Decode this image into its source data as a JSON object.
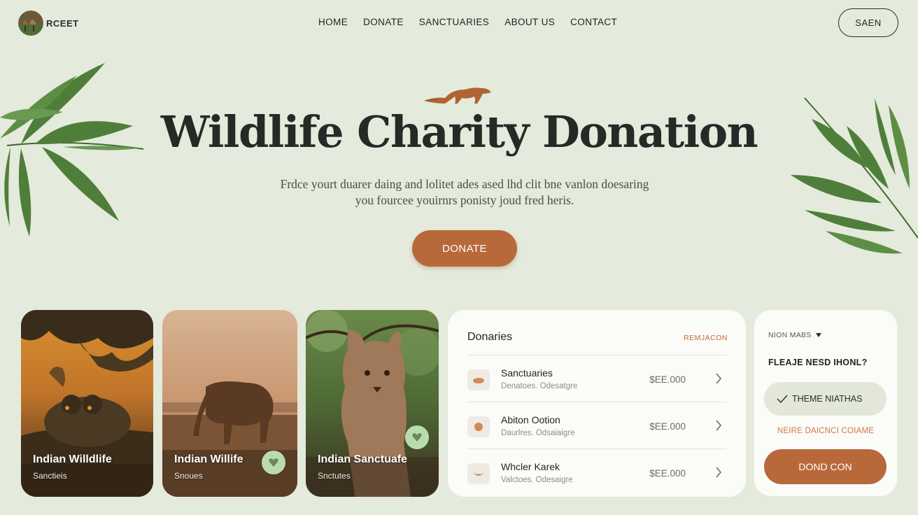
{
  "brand": {
    "name": "RCEET"
  },
  "nav": {
    "items": [
      "HOME",
      "DONATE",
      "SANCTUARIES",
      "ABOUT US",
      "CONTACT"
    ],
    "save_label": "SAEN"
  },
  "hero": {
    "title": "Wildlife Charity Donation",
    "subtitle_line1": "Frdce yourt duarer daing and lolitet ades ased lhd clit bne vanlon doesaring",
    "subtitle_line2": "you fourcee youirnrs ponisty joud fred heris.",
    "donate_label": "DONATE"
  },
  "cards": [
    {
      "title": "Indian Willdlife",
      "subtitle": "Sanctieis"
    },
    {
      "title": "Indian Willife",
      "subtitle": "Snoues"
    },
    {
      "title": "Indian Sanctuafe",
      "subtitle": "Snctutes"
    }
  ],
  "donations": {
    "title": "Donaries",
    "action": "REMJACON",
    "rows": [
      {
        "title": "Sanctuaries",
        "subtitle": "Denatoes. Odesatgre",
        "amount": "$EE.000"
      },
      {
        "title": "Abiton Ootion",
        "subtitle": "Daurlres. Odsaiaigre",
        "amount": "$EE.000"
      },
      {
        "title": "Whcler Karek",
        "subtitle": "Valctoes. Odesaigre",
        "amount": "$EE.000"
      }
    ]
  },
  "side": {
    "select_label": "NION MABS",
    "question": "FLEAJE NESD IHONL?",
    "theme_label": "THEME NIATHAS",
    "link_label": "NEIRE DAICNCI COIAME",
    "button_label": "DOND CON"
  },
  "colors": {
    "background": "#e4eadc",
    "accent": "#b8693a",
    "favorite": "#b9dcae"
  },
  "icons": [
    "leaf-icon",
    "mongoose-icon",
    "heart-icon",
    "chevron-right-icon",
    "caret-down-icon",
    "check-icon"
  ]
}
